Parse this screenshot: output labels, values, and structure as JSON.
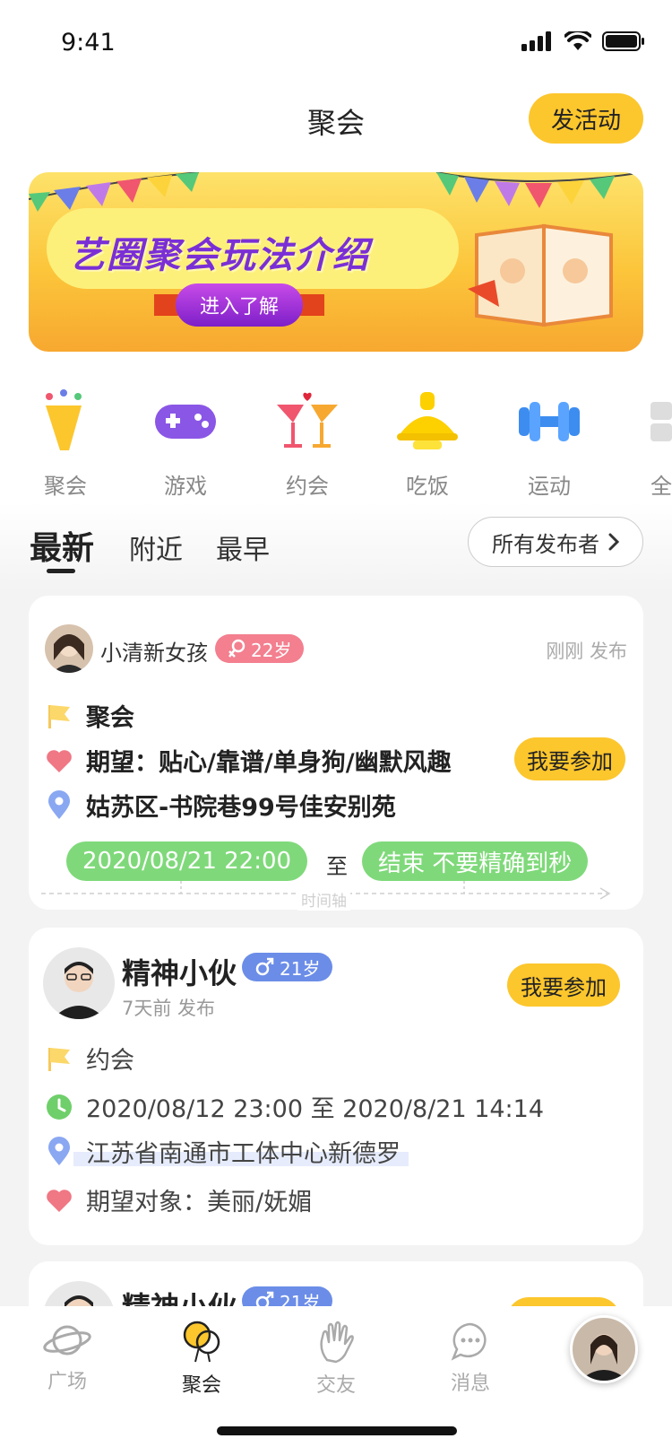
{
  "status": {
    "time": "9:41"
  },
  "header": {
    "title": "聚会",
    "post_button": "发活动"
  },
  "banner": {
    "headline": "艺圈聚会玩法介绍",
    "button": "进入了解"
  },
  "categories": [
    {
      "label": "聚会",
      "icon": "party-popper-icon"
    },
    {
      "label": "游戏",
      "icon": "gamepad-icon"
    },
    {
      "label": "约会",
      "icon": "cocktail-icon"
    },
    {
      "label": "吃饭",
      "icon": "food-cloche-icon"
    },
    {
      "label": "运动",
      "icon": "dumbbell-icon"
    },
    {
      "label": "全",
      "icon": "grid-icon"
    }
  ],
  "sort_tabs": {
    "newest": "最新",
    "nearby": "附近",
    "earliest": "最早",
    "filter_button": "所有发布者"
  },
  "cards": [
    {
      "name": "小清新女孩",
      "age": "22岁",
      "gender": "female",
      "posted": "刚刚 发布",
      "type": "聚会",
      "expectation": "期望：贴心/靠谱/单身狗/幽默风趣",
      "location": "姑苏区-书院巷99号佳安别苑",
      "start": "2020/08/21 22:00",
      "to": "至",
      "end": "结束 不要精确到秒",
      "timeline_label": "时间轴",
      "join_button": "我要参加"
    },
    {
      "name": "精神小伙",
      "age": "21岁",
      "gender": "male",
      "posted": "7天前 发布",
      "type": "约会",
      "time": "2020/08/12 23:00 至 2020/8/21 14:14",
      "location": "江苏省南通市工体中心新德罗",
      "expectation": "期望对象：美丽/妩媚",
      "join_button": "我要参加"
    },
    {
      "name": "精神小伙",
      "age": "21岁",
      "gender": "male"
    }
  ],
  "tabbar": [
    {
      "label": "广场",
      "icon": "planet-icon"
    },
    {
      "label": "聚会",
      "icon": "balloons-icon"
    },
    {
      "label": "交友",
      "icon": "wave-hand-icon"
    },
    {
      "label": "消息",
      "icon": "chat-bubble-icon"
    }
  ],
  "colors": {
    "accent": "#fcc62d",
    "female_badge": "#f37f8f",
    "male_badge": "#6b8de8",
    "time_pill": "#7fd97a"
  }
}
